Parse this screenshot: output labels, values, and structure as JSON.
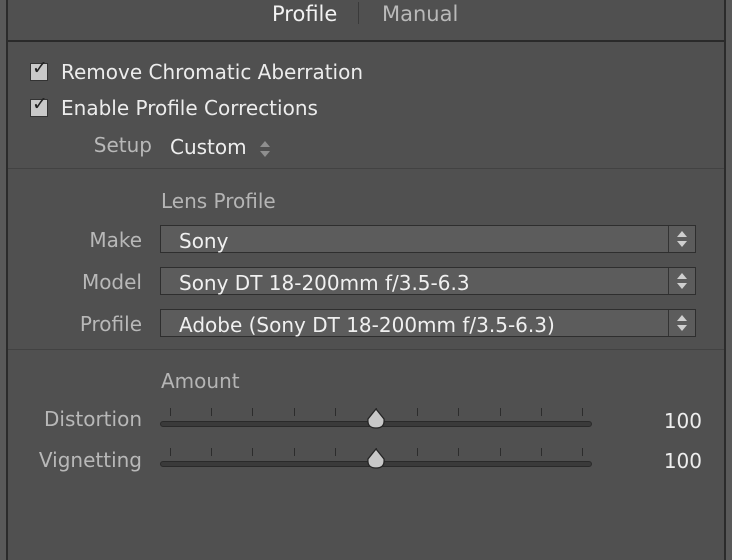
{
  "tabs": {
    "profile": "Profile",
    "manual": "Manual",
    "active": "Profile"
  },
  "checks": {
    "remove_ca": {
      "label": "Remove Chromatic Aberration",
      "checked": true
    },
    "enable_profile": {
      "label": "Enable Profile Corrections",
      "checked": true
    }
  },
  "setup": {
    "label": "Setup",
    "value": "Custom"
  },
  "lens_profile": {
    "title": "Lens Profile",
    "make": {
      "label": "Make",
      "value": "Sony"
    },
    "model": {
      "label": "Model",
      "value": "Sony DT 18-200mm f/3.5-6.3"
    },
    "profile": {
      "label": "Profile",
      "value": "Adobe (Sony DT 18-200mm f/3.5-6.3)"
    }
  },
  "amount": {
    "title": "Amount",
    "distortion": {
      "label": "Distortion",
      "value": "100",
      "position": 0.5
    },
    "vignetting": {
      "label": "Vignetting",
      "value": "100",
      "position": 0.5
    }
  },
  "icons": {
    "checkbox": "check-icon",
    "select": "up-down-arrows-icon",
    "slider_thumb": "slider-thumb-icon"
  }
}
